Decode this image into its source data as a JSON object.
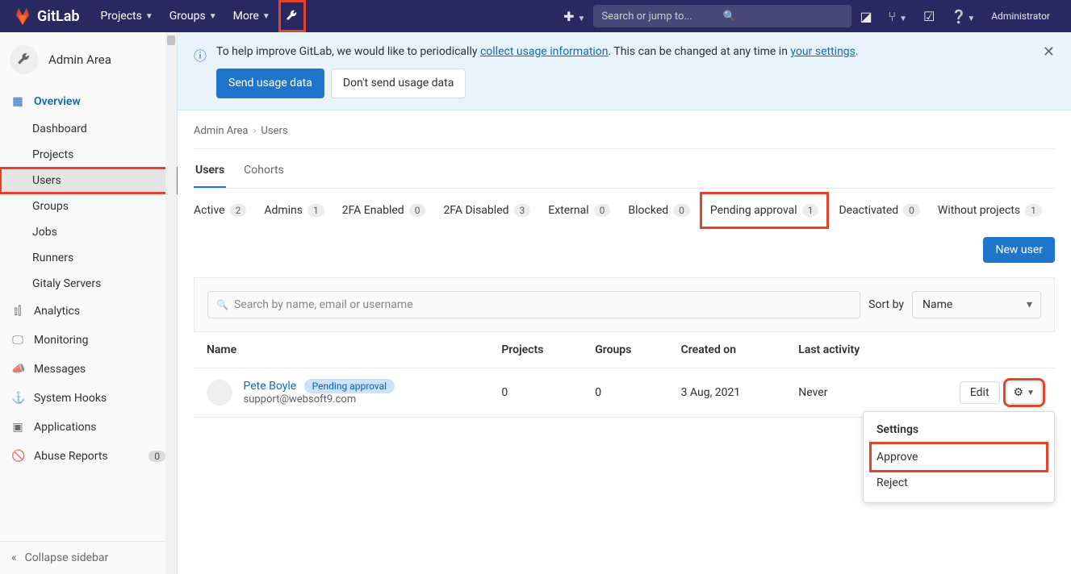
{
  "brand": "GitLab",
  "nav": {
    "projects": "Projects",
    "groups": "Groups",
    "more": "More"
  },
  "search_placeholder": "Search or jump to...",
  "user_label": "Administrator",
  "sidebar": {
    "title": "Admin Area",
    "overview": "Overview",
    "items": [
      "Dashboard",
      "Projects",
      "Users",
      "Groups",
      "Jobs",
      "Runners",
      "Gitaly Servers"
    ],
    "analytics": "Analytics",
    "monitoring": "Monitoring",
    "messages": "Messages",
    "hooks": "System Hooks",
    "apps": "Applications",
    "abuse": "Abuse Reports",
    "abuse_cnt": "0",
    "collapse": "Collapse sidebar"
  },
  "banner": {
    "pre": "To help improve GitLab, we would like to periodically ",
    "link1": "collect usage information",
    "mid": ". This can be changed at any time in ",
    "link2": "your settings",
    "suffix": ".",
    "send": "Send usage data",
    "dont": "Don't send usage data"
  },
  "crumbs": {
    "a": "Admin Area",
    "b": "Users"
  },
  "tabs": {
    "users": "Users",
    "cohorts": "Cohorts"
  },
  "filters": [
    {
      "label": "Active",
      "n": "2"
    },
    {
      "label": "Admins",
      "n": "1"
    },
    {
      "label": "2FA Enabled",
      "n": "0"
    },
    {
      "label": "2FA Disabled",
      "n": "3"
    },
    {
      "label": "External",
      "n": "0"
    },
    {
      "label": "Blocked",
      "n": "0"
    },
    {
      "label": "Pending approval",
      "n": "1"
    },
    {
      "label": "Deactivated",
      "n": "0"
    },
    {
      "label": "Without projects",
      "n": "1"
    }
  ],
  "new_user": "New user",
  "search_users_ph": "Search by name, email or username",
  "sort_label": "Sort by",
  "sort_value": "Name",
  "cols": {
    "name": "Name",
    "projects": "Projects",
    "groups": "Groups",
    "created": "Created on",
    "last": "Last activity"
  },
  "row": {
    "name": "Pete Boyle",
    "badge": "Pending approval",
    "email": "support@websoft9.com",
    "projects": "0",
    "groups": "0",
    "created": "3 Aug, 2021",
    "last": "Never",
    "edit": "Edit"
  },
  "dd": {
    "title": "Settings",
    "approve": "Approve",
    "reject": "Reject"
  }
}
